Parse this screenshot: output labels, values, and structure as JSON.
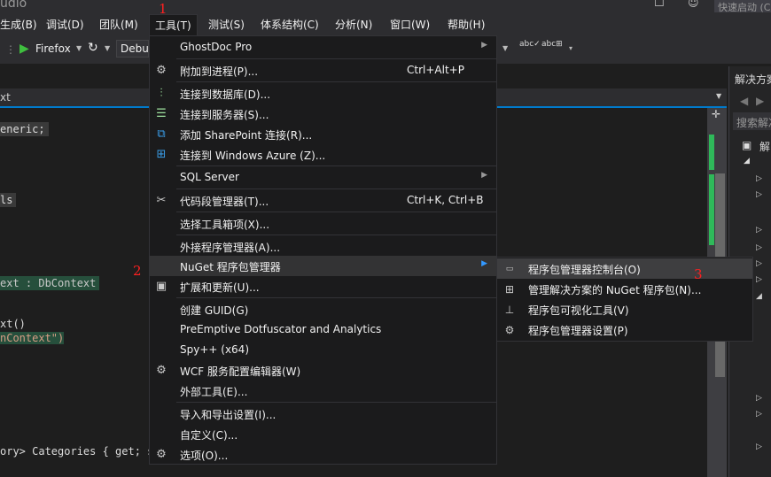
{
  "window": {
    "title_fragment": "udio",
    "quick_launch": "快速启动 (C"
  },
  "menubar": [
    "生成(B)",
    "调试(D)",
    "团队(M)",
    "工具(T)",
    "测试(S)",
    "体系结构(C)",
    "分析(N)",
    "窗口(W)",
    "帮助(H)"
  ],
  "toolbar": {
    "browser": "Firefox",
    "config": "Debu"
  },
  "editor": {
    "tab_fragment": "xt",
    "lines": [
      "eneric;",
      "ls",
      "ext : DbContext",
      "xt()",
      "nContext\")",
      "ory> Categories { get; s"
    ]
  },
  "solution_explorer": {
    "title": "解决方案",
    "search": "搜索解决",
    "root": "解"
  },
  "tools_menu": {
    "items": [
      {
        "label": "GhostDoc Pro",
        "shortcut": "",
        "submenu": true,
        "icon": ""
      },
      {
        "label": "附加到进程(P)...",
        "shortcut": "Ctrl+Alt+P",
        "submenu": false,
        "icon": "attach-process-icon"
      },
      {
        "label": "连接到数据库(D)...",
        "shortcut": "",
        "submenu": false,
        "icon": "connect-database-icon"
      },
      {
        "label": "连接到服务器(S)...",
        "shortcut": "",
        "submenu": false,
        "icon": "connect-server-icon"
      },
      {
        "label": "添加 SharePoint 连接(R)...",
        "shortcut": "",
        "submenu": false,
        "icon": "sharepoint-icon"
      },
      {
        "label": "连接到 Windows Azure (Z)...",
        "shortcut": "",
        "submenu": false,
        "icon": "windows-azure-icon"
      },
      {
        "label": "SQL Server",
        "shortcut": "",
        "submenu": true,
        "icon": ""
      },
      {
        "label": "代码段管理器(T)...",
        "shortcut": "Ctrl+K, Ctrl+B",
        "submenu": false,
        "icon": "code-snippets-icon"
      },
      {
        "label": "选择工具箱项(X)...",
        "shortcut": "",
        "submenu": false,
        "icon": ""
      },
      {
        "label": "外接程序管理器(A)...",
        "shortcut": "",
        "submenu": false,
        "icon": ""
      },
      {
        "label": "NuGet 程序包管理器",
        "shortcut": "",
        "submenu": true,
        "icon": ""
      },
      {
        "label": "扩展和更新(U)...",
        "shortcut": "",
        "submenu": false,
        "icon": "extensions-icon"
      },
      {
        "label": "创建 GUID(G)",
        "shortcut": "",
        "submenu": false,
        "icon": ""
      },
      {
        "label": "PreEmptive Dotfuscator and Analytics",
        "shortcut": "",
        "submenu": false,
        "icon": ""
      },
      {
        "label": "Spy++ (x64)",
        "shortcut": "",
        "submenu": false,
        "icon": ""
      },
      {
        "label": "WCF 服务配置编辑器(W)",
        "shortcut": "",
        "submenu": false,
        "icon": "wcf-config-icon"
      },
      {
        "label": "外部工具(E)...",
        "shortcut": "",
        "submenu": false,
        "icon": ""
      },
      {
        "label": "导入和导出设置(I)...",
        "shortcut": "",
        "submenu": false,
        "icon": ""
      },
      {
        "label": "自定义(C)...",
        "shortcut": "",
        "submenu": false,
        "icon": ""
      },
      {
        "label": "选项(O)...",
        "shortcut": "",
        "submenu": false,
        "icon": "gear-icon"
      }
    ]
  },
  "nuget_submenu": {
    "items": [
      {
        "label": "程序包管理器控制台(O)",
        "icon": "console-icon"
      },
      {
        "label": "管理解决方案的 NuGet 程序包(N)...",
        "icon": "package-icon"
      },
      {
        "label": "程序包可视化工具(V)",
        "icon": "hierarchy-icon"
      },
      {
        "label": "程序包管理器设置(P)",
        "icon": "gear-icon"
      }
    ]
  },
  "annotations": [
    "1",
    "2",
    "3"
  ]
}
